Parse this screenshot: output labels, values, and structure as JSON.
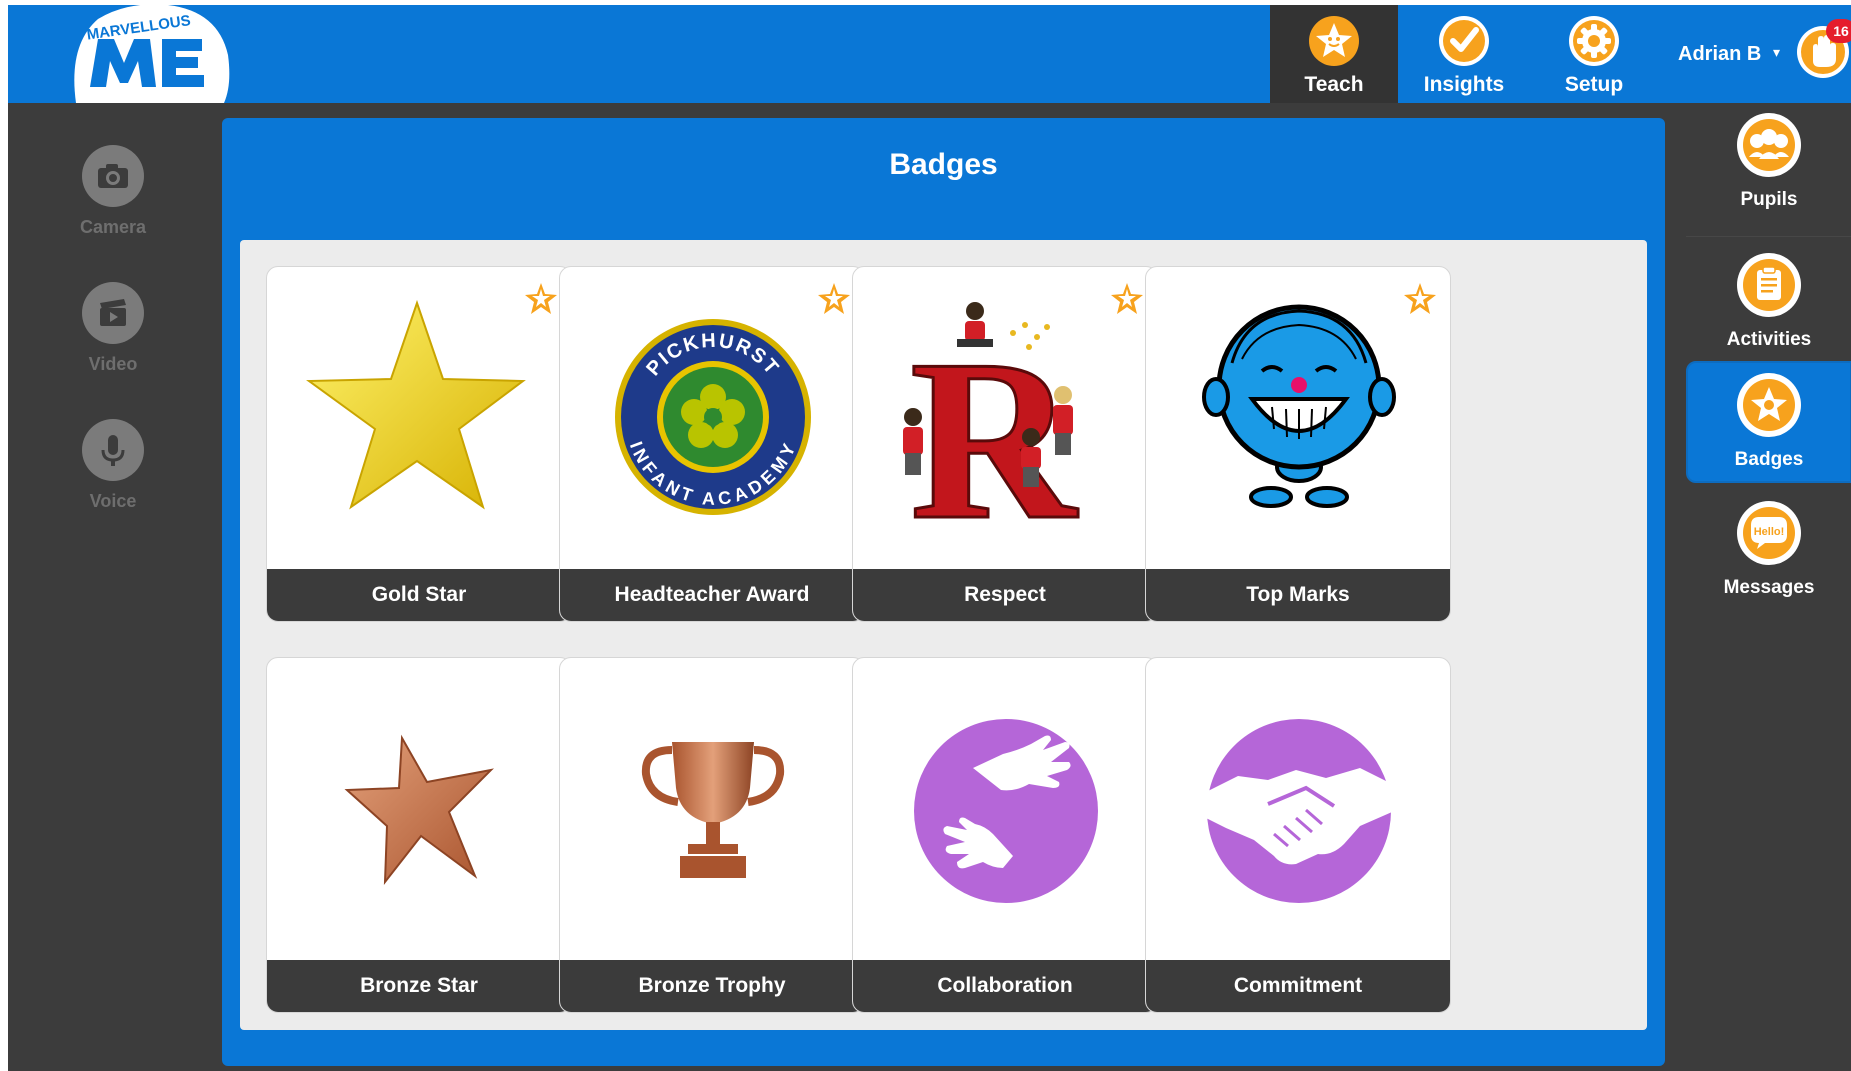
{
  "app": {
    "logo_text": "MARVELLOUS ME"
  },
  "nav": {
    "tabs": [
      {
        "label": "Teach",
        "active": true,
        "icon": "teach-star-icon"
      },
      {
        "label": "Insights",
        "active": false,
        "icon": "checkmark-icon"
      },
      {
        "label": "Setup",
        "active": false,
        "icon": "gear-icon"
      }
    ]
  },
  "user": {
    "name": "Adrian B",
    "caret": "▾",
    "notifications": "16"
  },
  "left_sidebar": {
    "items": [
      {
        "label": "Camera",
        "icon": "camera-icon"
      },
      {
        "label": "Video",
        "icon": "video-icon"
      },
      {
        "label": "Voice",
        "icon": "microphone-icon"
      }
    ]
  },
  "right_sidebar": {
    "items": [
      {
        "label": "Pupils",
        "icon": "pupils-icon",
        "active": false
      },
      {
        "label": "Activities",
        "icon": "clipboard-icon",
        "active": false
      },
      {
        "label": "Badges",
        "icon": "badge-star-icon",
        "active": true
      },
      {
        "label": "Messages",
        "icon": "hello-bubble-icon",
        "active": false
      }
    ]
  },
  "panel": {
    "title": "Badges"
  },
  "badges": [
    {
      "name": "Gold Star",
      "favourite": true,
      "image": "gold-star"
    },
    {
      "name": "Headteacher Award",
      "favourite": true,
      "image": "school-crest",
      "crest_top": "PICKHURST",
      "crest_bottom": "INFANT ACADEMY"
    },
    {
      "name": "Respect",
      "favourite": true,
      "image": "respect-letter-r",
      "letter": "R"
    },
    {
      "name": "Top Marks",
      "favourite": true,
      "image": "blue-character-face"
    },
    {
      "name": "Bronze Star",
      "favourite": false,
      "image": "bronze-star"
    },
    {
      "name": "Bronze Trophy",
      "favourite": false,
      "image": "bronze-trophy"
    },
    {
      "name": "Collaboration",
      "favourite": false,
      "image": "helping-hands"
    },
    {
      "name": "Commitment",
      "favourite": false,
      "image": "handshake"
    }
  ],
  "colors": {
    "brand_blue": "#0a77d6",
    "dark_background": "#3c3c3c",
    "accent_orange": "#f7a21d",
    "badge_label_bg": "#3b3b3b",
    "notification_red": "#e51d2c",
    "purple": "#b566d8"
  }
}
